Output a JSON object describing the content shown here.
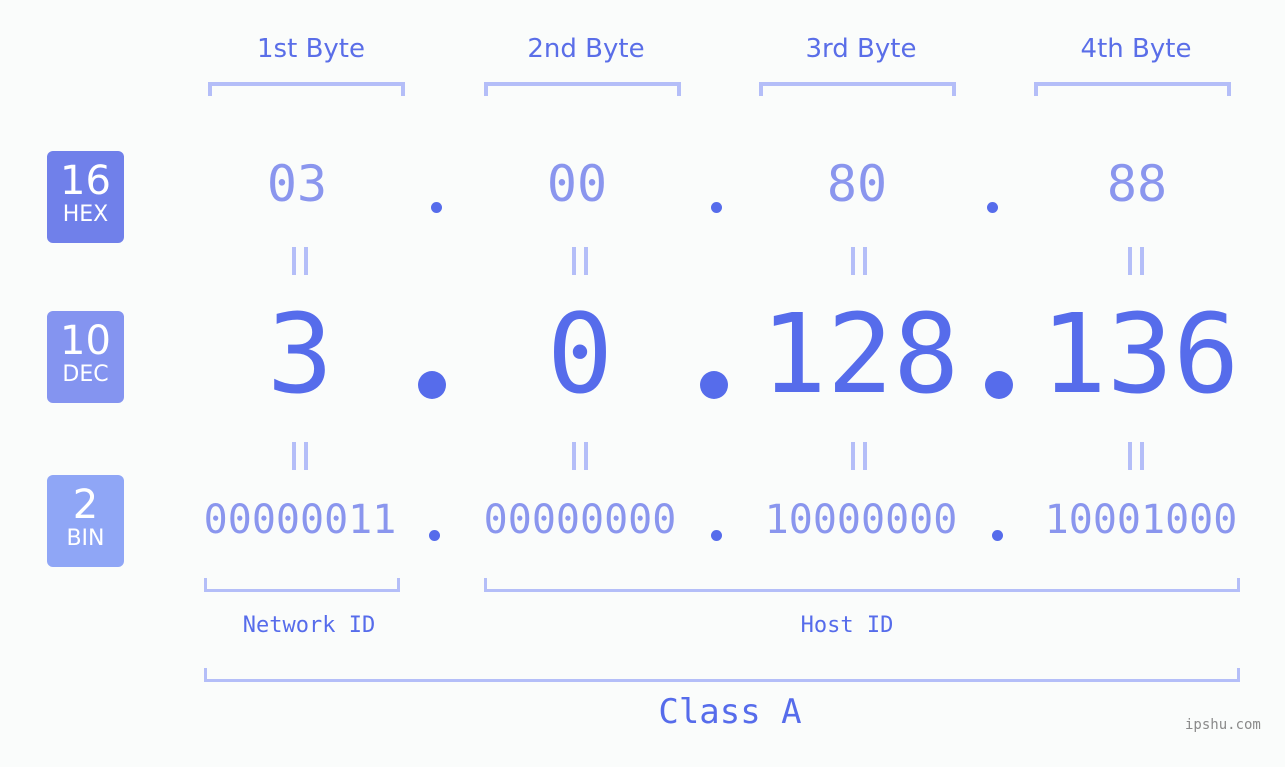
{
  "byte_headers": [
    "1st Byte",
    "2nd Byte",
    "3rd Byte",
    "4th Byte"
  ],
  "badges": {
    "hex": {
      "number": "16",
      "label": "HEX",
      "color": "#7080ea"
    },
    "dec": {
      "number": "10",
      "label": "DEC",
      "color": "#8494f0"
    },
    "bin": {
      "number": "2",
      "label": "BIN",
      "color": "#8fa6f6"
    }
  },
  "ip": {
    "hex": [
      "03",
      "00",
      "80",
      "88"
    ],
    "dec": [
      "3",
      "0",
      "128",
      "136"
    ],
    "bin": [
      "00000011",
      "00000000",
      "10000000",
      "10001000"
    ]
  },
  "labels": {
    "network_id": "Network ID",
    "host_id": "Host ID",
    "class": "Class A"
  },
  "watermark": "ipshu.com",
  "colors": {
    "accent": "#566ceb",
    "light": "#8a96ee",
    "bracket": "#b4bef8"
  }
}
